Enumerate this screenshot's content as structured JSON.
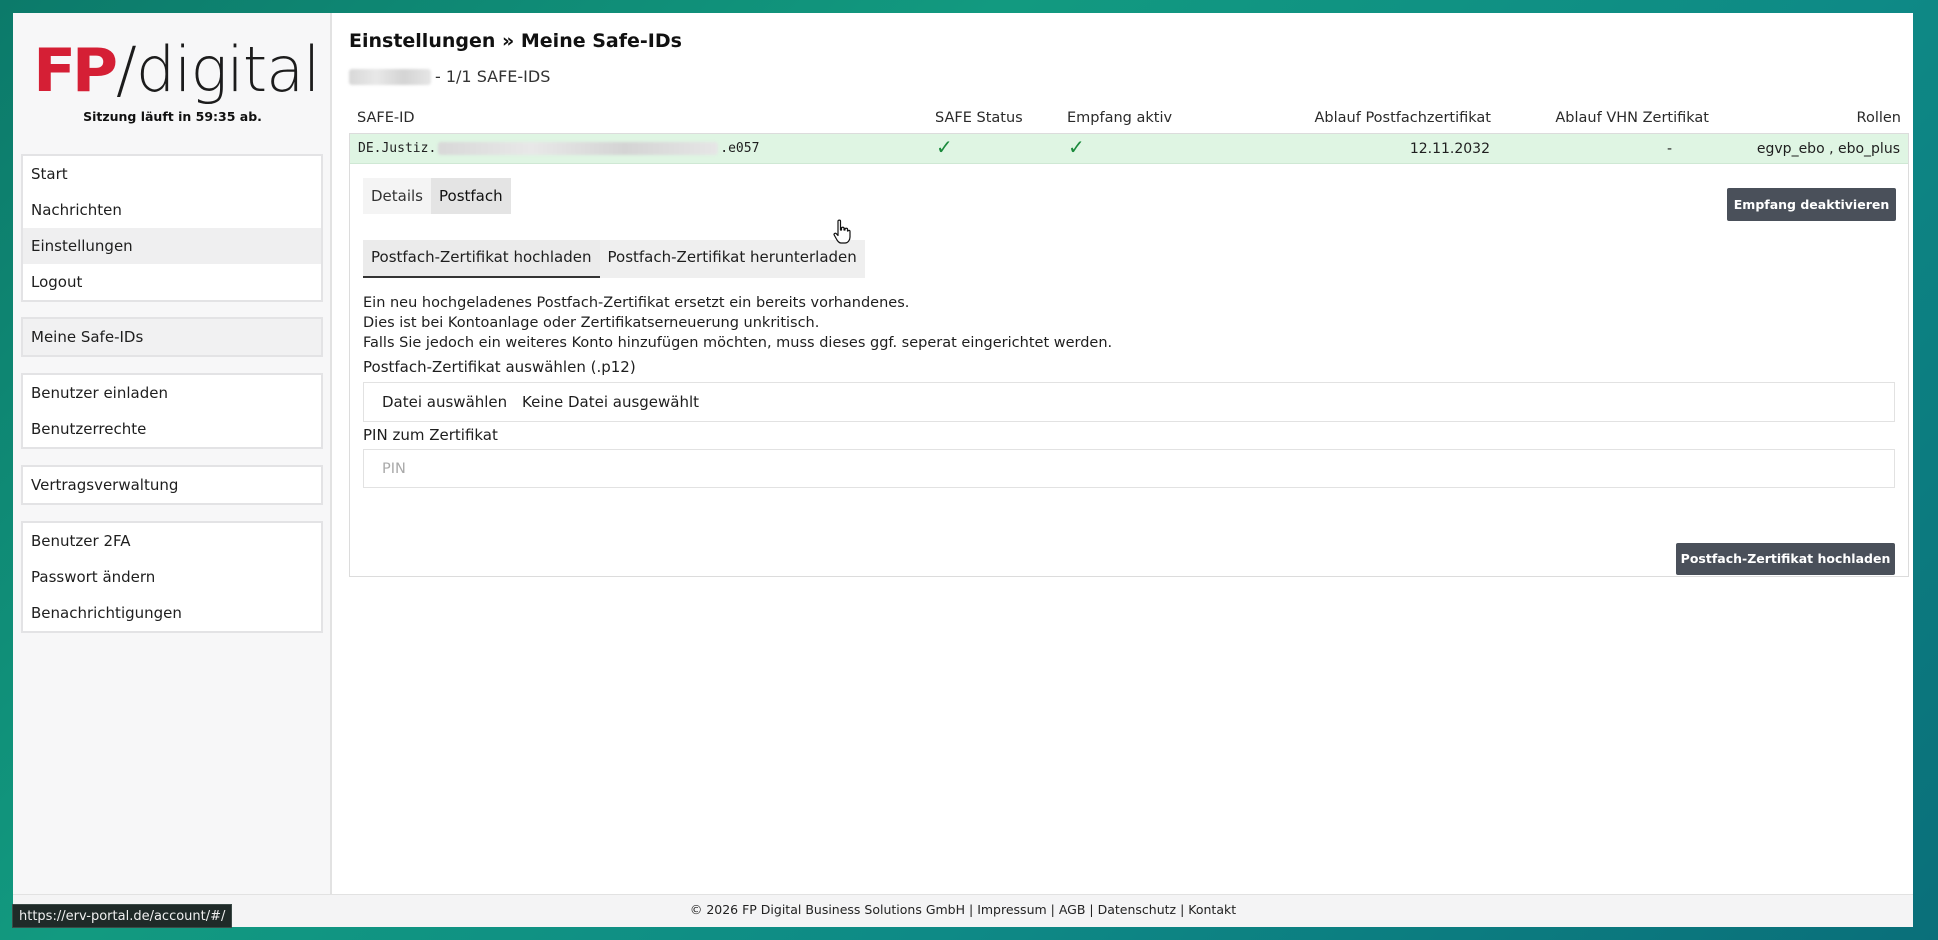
{
  "sidebar": {
    "logo_brand": "FP",
    "logo_text": "/digital",
    "session_text": "Sitzung läuft in 59:35 ab.",
    "group1": [
      "Start",
      "Nachrichten",
      "Einstellungen",
      "Logout"
    ],
    "group2": [
      "Meine Safe-IDs"
    ],
    "group3": [
      "Benutzer einladen",
      "Benutzerrechte"
    ],
    "group4": [
      "Vertragsverwaltung"
    ],
    "group5": [
      "Benutzer 2FA",
      "Passwort ändern",
      "Benachrichtigungen"
    ]
  },
  "main": {
    "title": "Einstellungen » Meine Safe-IDs",
    "subtitle_suffix": "- 1/1 SAFE-IDS",
    "columns": {
      "safe_id": "SAFE-ID",
      "safe_status": "SAFE Status",
      "empfang": "Empfang aktiv",
      "ablauf_postfach": "Ablauf Postfachzertifikat",
      "ablauf_vhn": "Ablauf VHN Zertifikat",
      "rollen": "Rollen"
    },
    "row": {
      "safe_id_prefix": "DE.Justiz.",
      "safe_id_suffix": ".e057",
      "safe_status": "✓",
      "empfang": "✓",
      "ablauf_postfach": "12.11.2032",
      "ablauf_vhn": "-",
      "rollen": "egvp_ebo , ebo_plus"
    },
    "tabs": [
      "Details",
      "Postfach"
    ],
    "deactivate_button": "Empfang deaktivieren",
    "subtabs": [
      "Postfach-Zertifikat hochladen",
      "Postfach-Zertifikat herunterladen"
    ],
    "info_lines": [
      "Ein neu hochgeladenes Postfach-Zertifikat ersetzt ein bereits vorhandenes.",
      "Dies ist bei Kontoanlage oder Zertifikatserneuerung unkritisch.",
      "Falls Sie jedoch ein weiteres Konto hinzufügen möchten, muss dieses ggf. seperat eingerichtet werden."
    ],
    "file_label": "Postfach-Zertifikat auswählen (.p12)",
    "file_button": "Datei auswählen",
    "file_none": "Keine Datei ausgewählt",
    "pin_label": "PIN zum Zertifikat",
    "pin_placeholder": "PIN",
    "upload_button": "Postfach-Zertifikat hochladen"
  },
  "footer": {
    "copyright": "© 2026 FP Digital Business Solutions GmbH",
    "links": [
      "Impressum",
      "AGB",
      "Datenschutz",
      "Kontakt"
    ]
  },
  "statusbar_url": "https://erv-portal.de/account/#/",
  "colors": {
    "brand_red": "#d51f35",
    "row_green": "#dff5e3",
    "button_dark": "#4a505a"
  }
}
